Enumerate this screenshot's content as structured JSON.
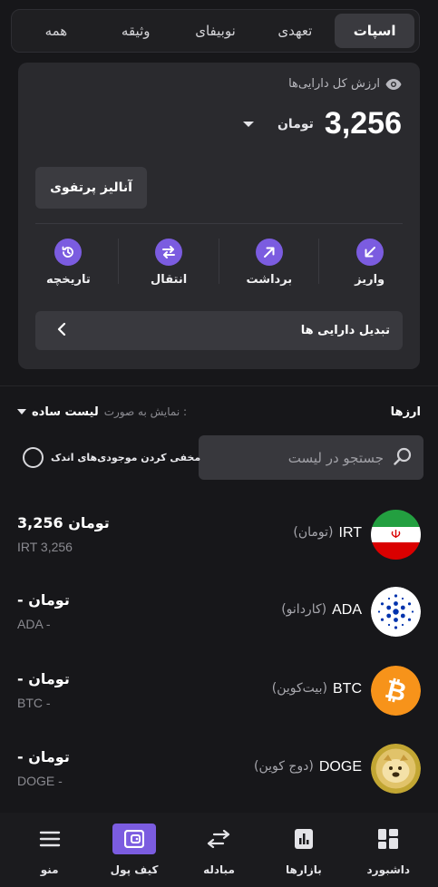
{
  "tabs": [
    {
      "label": "اسپات",
      "active": true
    },
    {
      "label": "تعهدی",
      "active": false
    },
    {
      "label": "نوبیفای",
      "active": false
    },
    {
      "label": "وثیقه",
      "active": false
    },
    {
      "label": "همه",
      "active": false
    }
  ],
  "balance": {
    "label": "ارزش کل دارایی‌ها",
    "value": "3,256",
    "unit": "تومان",
    "eye_icon": "eye-icon"
  },
  "analyze_button": "آنالیز پرتفوی",
  "actions": [
    {
      "label": "واریز",
      "icon": "deposit-arrow-icon"
    },
    {
      "label": "برداشت",
      "icon": "withdraw-arrow-icon"
    },
    {
      "label": "انتقال",
      "icon": "transfer-icon"
    },
    {
      "label": "تاریخچه",
      "icon": "history-icon"
    }
  ],
  "convert_assets": "تبدیل دارایی ها",
  "assets_section": {
    "title": "ارزها",
    "view_label": "نمایش به صورت :",
    "view_value": "لیست ساده",
    "search_placeholder": "جستجو در لیست",
    "hide_small_label": "مخفی کردن موجودی‌های اندک"
  },
  "assets": [
    {
      "symbol": "IRT",
      "name": "(تومان)",
      "balance": "3,256 تومان",
      "sub": "IRT 3,256",
      "logo": "iran-flag-icon"
    },
    {
      "symbol": "ADA",
      "name": "(کاردانو)",
      "balance": "- تومان",
      "sub": "ADA -",
      "logo": "cardano-icon"
    },
    {
      "symbol": "BTC",
      "name": "(بیت‌کوین)",
      "balance": "- تومان",
      "sub": "BTC -",
      "logo": "bitcoin-icon"
    },
    {
      "symbol": "DOGE",
      "name": "(دوج کوین)",
      "balance": "- تومان",
      "sub": "DOGE -",
      "logo": "dogecoin-icon"
    }
  ],
  "bottom_nav": [
    {
      "label": "داشبورد",
      "icon": "dashboard-icon",
      "active": false
    },
    {
      "label": "بازارها",
      "icon": "markets-icon",
      "active": false
    },
    {
      "label": "مبادله",
      "icon": "exchange-icon",
      "active": false
    },
    {
      "label": "کیف پول",
      "icon": "wallet-icon",
      "active": true
    },
    {
      "label": "منو",
      "icon": "menu-icon",
      "active": false
    }
  ],
  "colors": {
    "background": "#17171a",
    "card": "#2a2a2e",
    "accent": "#7b5ce0",
    "bitcoin": "#f7931a",
    "cardano": "#0033ad"
  }
}
